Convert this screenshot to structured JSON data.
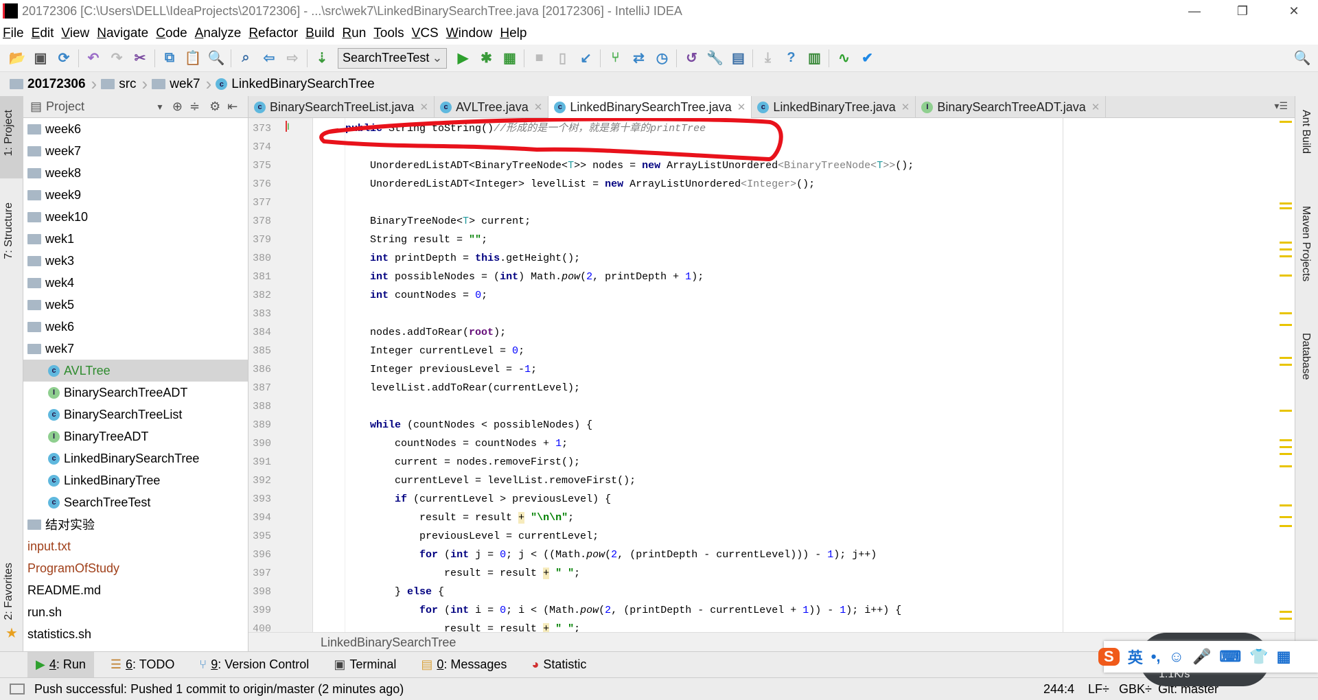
{
  "window": {
    "title": "20172306 [C:\\Users\\DELL\\IdeaProjects\\20172306] - ...\\src\\wek7\\LinkedBinarySearchTree.java [20172306] - IntelliJ IDEA",
    "logo": "IJ",
    "minimize": "—",
    "restore": "❐",
    "close": "✕"
  },
  "menu": [
    "File",
    "Edit",
    "View",
    "Navigate",
    "Code",
    "Analyze",
    "Refactor",
    "Build",
    "Run",
    "Tools",
    "VCS",
    "Window",
    "Help"
  ],
  "toolbar": {
    "run_config": "SearchTreeTest",
    "icons_left": [
      {
        "name": "open-icon",
        "g": "📂",
        "c": "#d9a441"
      },
      {
        "name": "save-icon",
        "g": "▣",
        "c": "#555"
      },
      {
        "name": "sync-icon",
        "g": "⟳",
        "c": "#3a86c8"
      },
      {
        "name": "undo-icon",
        "g": "↶",
        "c": "#9a6cc8"
      },
      {
        "name": "redo-icon",
        "g": "↷",
        "c": "#bbb"
      },
      {
        "name": "cut-icon",
        "g": "✂",
        "c": "#7a4aa0"
      },
      {
        "name": "copy-icon",
        "g": "⧉",
        "c": "#3a86c8"
      },
      {
        "name": "paste-icon",
        "g": "📋",
        "c": "#c08030"
      },
      {
        "name": "find-icon",
        "g": "🔍",
        "c": "#3a6ea5"
      },
      {
        "name": "replace-icon",
        "g": "⌕",
        "c": "#3a6ea5"
      },
      {
        "name": "back-icon",
        "g": "⇦",
        "c": "#3a86c8"
      },
      {
        "name": "forward-icon",
        "g": "⇨",
        "c": "#bbb"
      },
      {
        "name": "build-icon",
        "g": "⇣",
        "c": "#3a9a3a"
      }
    ],
    "icons_right": [
      {
        "name": "run-icon",
        "g": "▶",
        "c": "#2ea02e"
      },
      {
        "name": "debug-icon",
        "g": "✱",
        "c": "#3a9a3a"
      },
      {
        "name": "coverage-icon",
        "g": "▦",
        "c": "#3a9a3a"
      },
      {
        "name": "stop-icon",
        "g": "■",
        "c": "#bbb"
      },
      {
        "name": "attach-icon",
        "g": "▯",
        "c": "#bbb"
      },
      {
        "name": "vcs-update-icon",
        "g": "↙",
        "c": "#3a86c8"
      },
      {
        "name": "vcs-branch-icon",
        "g": "⑂",
        "c": "#4caf50"
      },
      {
        "name": "vcs-merge-icon",
        "g": "⇄",
        "c": "#3a86c8"
      },
      {
        "name": "history-icon",
        "g": "◷",
        "c": "#3a86c8"
      },
      {
        "name": "revert-icon",
        "g": "↺",
        "c": "#7a4aa0"
      },
      {
        "name": "settings-icon",
        "g": "🔧",
        "c": "#c08030"
      },
      {
        "name": "project-structure-icon",
        "g": "▤",
        "c": "#3a6ea5"
      },
      {
        "name": "download-icon",
        "g": "⤓",
        "c": "#bbb"
      },
      {
        "name": "help-icon",
        "g": "?",
        "c": "#3a86c8"
      },
      {
        "name": "sdk-icon",
        "g": "▥",
        "c": "#3a8a3a"
      },
      {
        "name": "statistic-icon",
        "g": "∿",
        "c": "#2ea02e"
      },
      {
        "name": "task-icon",
        "g": "✔",
        "c": "#1e88e5"
      }
    ],
    "search": "🔍"
  },
  "breadcrumb": [
    "20172306",
    "src",
    "wek7",
    "LinkedBinarySearchTree"
  ],
  "left_strip": {
    "project": "1: Project",
    "structure": "7: Structure",
    "favorites": "2: Favorites"
  },
  "project": {
    "title": "Project",
    "items": [
      {
        "label": "week6",
        "type": "folder",
        "level": 0
      },
      {
        "label": "week7",
        "type": "folder",
        "level": 0
      },
      {
        "label": "week8",
        "type": "folder",
        "level": 0
      },
      {
        "label": "week9",
        "type": "folder",
        "level": 0
      },
      {
        "label": "week10",
        "type": "folder",
        "level": 0
      },
      {
        "label": "wek1",
        "type": "folder",
        "level": 0
      },
      {
        "label": "wek3",
        "type": "folder",
        "level": 0
      },
      {
        "label": "wek4",
        "type": "folder",
        "level": 0
      },
      {
        "label": "wek5",
        "type": "folder",
        "level": 0
      },
      {
        "label": "wek6",
        "type": "folder",
        "level": 0
      },
      {
        "label": "wek7",
        "type": "folder",
        "level": 0
      },
      {
        "label": "AVLTree",
        "type": "class",
        "level": 1,
        "selected": true,
        "color": "#2e8b2e"
      },
      {
        "label": "BinarySearchTreeADT",
        "type": "interface",
        "level": 1
      },
      {
        "label": "BinarySearchTreeList",
        "type": "class",
        "level": 1
      },
      {
        "label": "BinaryTreeADT",
        "type": "interface",
        "level": 1
      },
      {
        "label": "LinkedBinarySearchTree",
        "type": "class",
        "level": 1
      },
      {
        "label": "LinkedBinaryTree",
        "type": "class",
        "level": 1
      },
      {
        "label": "SearchTreeTest",
        "type": "class",
        "level": 1
      },
      {
        "label": "结对实验",
        "type": "folder",
        "level": 0
      },
      {
        "label": "input.txt",
        "type": "file",
        "level": 0,
        "color": "#a0401a"
      },
      {
        "label": "ProgramOfStudy",
        "type": "file",
        "level": 0,
        "color": "#a0401a"
      },
      {
        "label": "README.md",
        "type": "file",
        "level": 0
      },
      {
        "label": "run.sh",
        "type": "file",
        "level": 0
      },
      {
        "label": "statistics.sh",
        "type": "file",
        "level": 0
      }
    ]
  },
  "tabs": [
    {
      "label": "BinarySearchTreeList.java",
      "type": "class"
    },
    {
      "label": "AVLTree.java",
      "type": "class"
    },
    {
      "label": "LinkedBinarySearchTree.java",
      "type": "class",
      "active": true
    },
    {
      "label": "LinkedBinaryTree.java",
      "type": "class"
    },
    {
      "label": "BinarySearchTreeADT.java",
      "type": "interface"
    }
  ],
  "editor": {
    "lines": [
      {
        "n": "373",
        "t": [
          [
            "    ",
            "pl"
          ],
          [
            "public",
            "kw"
          ],
          [
            " String toString()",
            "pl"
          ],
          [
            "//形成的是一个树，就是第十章的printTree",
            "cm"
          ]
        ]
      },
      {
        "n": "374",
        "t": []
      },
      {
        "n": "375",
        "t": [
          [
            "        UnorderedListADT<BinaryTreeNode<",
            "pl"
          ],
          [
            "T",
            "tp"
          ],
          [
            ">> nodes = ",
            "pl"
          ],
          [
            "new",
            "kw"
          ],
          [
            " ArrayListUnordered",
            "pl"
          ],
          [
            "<BinaryTreeNode<",
            "gen"
          ],
          [
            "T",
            "tp"
          ],
          [
            ">>",
            "gen"
          ],
          [
            "();",
            "pl"
          ]
        ]
      },
      {
        "n": "376",
        "t": [
          [
            "        UnorderedListADT<Integer> levelList = ",
            "pl"
          ],
          [
            "new",
            "kw"
          ],
          [
            " ArrayListUnordered",
            "pl"
          ],
          [
            "<Integer>",
            "gen"
          ],
          [
            "();",
            "pl"
          ]
        ]
      },
      {
        "n": "377",
        "t": []
      },
      {
        "n": "378",
        "t": [
          [
            "        BinaryTreeNode<",
            "pl"
          ],
          [
            "T",
            "tp"
          ],
          [
            "> current;",
            "pl"
          ]
        ]
      },
      {
        "n": "379",
        "t": [
          [
            "        String result = ",
            "pl"
          ],
          [
            "\"\"",
            "str"
          ],
          [
            ";",
            "pl"
          ]
        ]
      },
      {
        "n": "380",
        "t": [
          [
            "        ",
            "pl"
          ],
          [
            "int",
            "kw"
          ],
          [
            " printDepth = ",
            "pl"
          ],
          [
            "this",
            "kw"
          ],
          [
            ".getHeight();",
            "pl"
          ]
        ]
      },
      {
        "n": "381",
        "t": [
          [
            "        ",
            "pl"
          ],
          [
            "int",
            "kw"
          ],
          [
            " possibleNodes = (",
            "pl"
          ],
          [
            "int",
            "kw"
          ],
          [
            ") Math.",
            "pl"
          ],
          [
            "pow",
            "it"
          ],
          [
            "(",
            "pl"
          ],
          [
            "2",
            "num"
          ],
          [
            ", printDepth + ",
            "pl"
          ],
          [
            "1",
            "num"
          ],
          [
            ");",
            "pl"
          ]
        ]
      },
      {
        "n": "382",
        "t": [
          [
            "        ",
            "pl"
          ],
          [
            "int",
            "kw"
          ],
          [
            " countNodes = ",
            "pl"
          ],
          [
            "0",
            "num"
          ],
          [
            ";",
            "pl"
          ]
        ]
      },
      {
        "n": "383",
        "t": []
      },
      {
        "n": "384",
        "t": [
          [
            "        nodes.addToRear(",
            "pl"
          ],
          [
            "root",
            "fld"
          ],
          [
            ");",
            "pl"
          ]
        ]
      },
      {
        "n": "385",
        "t": [
          [
            "        Integer currentLevel = ",
            "pl"
          ],
          [
            "0",
            "num"
          ],
          [
            ";",
            "pl"
          ]
        ]
      },
      {
        "n": "386",
        "t": [
          [
            "        Integer previousLevel = -",
            "pl"
          ],
          [
            "1",
            "num"
          ],
          [
            ";",
            "pl"
          ]
        ]
      },
      {
        "n": "387",
        "t": [
          [
            "        levelList.addToRear(currentLevel);",
            "pl"
          ]
        ]
      },
      {
        "n": "388",
        "t": []
      },
      {
        "n": "389",
        "t": [
          [
            "        ",
            "pl"
          ],
          [
            "while",
            "kw"
          ],
          [
            " (countNodes < possibleNodes) {",
            "pl"
          ]
        ]
      },
      {
        "n": "390",
        "t": [
          [
            "            countNodes = countNodes + ",
            "pl"
          ],
          [
            "1",
            "num"
          ],
          [
            ";",
            "pl"
          ]
        ]
      },
      {
        "n": "391",
        "t": [
          [
            "            current = nodes.removeFirst();",
            "pl"
          ]
        ]
      },
      {
        "n": "392",
        "t": [
          [
            "            currentLevel = levelList.removeFirst();",
            "pl"
          ]
        ]
      },
      {
        "n": "393",
        "t": [
          [
            "            ",
            "pl"
          ],
          [
            "if",
            "kw"
          ],
          [
            " (currentLevel > previousLevel) {",
            "pl"
          ]
        ]
      },
      {
        "n": "394",
        "t": [
          [
            "                result = result ",
            "pl"
          ],
          [
            "+",
            "hl"
          ],
          [
            " ",
            "pl"
          ],
          [
            "\"\\n\\n\"",
            "str"
          ],
          [
            ";",
            "pl"
          ]
        ]
      },
      {
        "n": "395",
        "t": [
          [
            "                previousLevel = currentLevel;",
            "pl"
          ]
        ]
      },
      {
        "n": "396",
        "t": [
          [
            "                ",
            "pl"
          ],
          [
            "for",
            "kw"
          ],
          [
            " (",
            "pl"
          ],
          [
            "int",
            "kw"
          ],
          [
            " j = ",
            "pl"
          ],
          [
            "0",
            "num"
          ],
          [
            "; j < ((Math.",
            "pl"
          ],
          [
            "pow",
            "it"
          ],
          [
            "(",
            "pl"
          ],
          [
            "2",
            "num"
          ],
          [
            ", (printDepth - currentLevel))) - ",
            "pl"
          ],
          [
            "1",
            "num"
          ],
          [
            "); j++)",
            "pl"
          ]
        ]
      },
      {
        "n": "397",
        "t": [
          [
            "                    result = result ",
            "pl"
          ],
          [
            "+",
            "hl"
          ],
          [
            " ",
            "pl"
          ],
          [
            "\" \"",
            "str"
          ],
          [
            ";",
            "pl"
          ]
        ]
      },
      {
        "n": "398",
        "t": [
          [
            "            } ",
            "pl"
          ],
          [
            "else",
            "kw"
          ],
          [
            " {",
            "pl"
          ]
        ]
      },
      {
        "n": "399",
        "t": [
          [
            "                ",
            "pl"
          ],
          [
            "for",
            "kw"
          ],
          [
            " (",
            "pl"
          ],
          [
            "int",
            "kw"
          ],
          [
            " i = ",
            "pl"
          ],
          [
            "0",
            "num"
          ],
          [
            "; i < (Math.",
            "pl"
          ],
          [
            "pow",
            "it"
          ],
          [
            "(",
            "pl"
          ],
          [
            "2",
            "num"
          ],
          [
            ", (printDepth - currentLevel + ",
            "pl"
          ],
          [
            "1",
            "num"
          ],
          [
            ")) - ",
            "pl"
          ],
          [
            "1",
            "num"
          ],
          [
            "); i++) {",
            "pl"
          ]
        ]
      },
      {
        "n": "400",
        "t": [
          [
            "                    result = result ",
            "pl"
          ],
          [
            "+",
            "hl"
          ],
          [
            " ",
            "pl"
          ],
          [
            "\" \"",
            "str"
          ],
          [
            ";",
            "pl"
          ]
        ]
      }
    ],
    "footer": "LinkedBinarySearchTree",
    "annotation_color": "#e8121b"
  },
  "right_strip": {
    "ant": "Ant Build",
    "maven": "Maven Projects",
    "database": "Database"
  },
  "tool_windows": [
    {
      "key": "4",
      "label": ": Run",
      "icon": "▶",
      "color": "#2ea02e",
      "active": true
    },
    {
      "key": "6",
      "label": ": TODO",
      "icon": "☰",
      "color": "#c08030"
    },
    {
      "key": "9",
      "label": ": Version Control",
      "icon": "⑂",
      "color": "#3a86c8"
    },
    {
      "key": "",
      "label": "Terminal",
      "icon": "▣",
      "color": "#444"
    },
    {
      "key": "0",
      "label": ": Messages",
      "icon": "▤",
      "color": "#d9a441"
    },
    {
      "key": "",
      "label": "Statistic",
      "icon": "◕",
      "color": "#d03030"
    }
  ],
  "status": {
    "message": "Push successful: Pushed 1 commit to origin/master (2 minutes ago)",
    "position": "244:4",
    "line_sep": "LF÷",
    "encoding": "GBK÷",
    "vcs": "Git: master"
  },
  "ime": {
    "logo": "S",
    "lang": "英",
    "items": [
      "•,",
      "☺",
      "🎤",
      "⌨",
      "👕",
      "▦"
    ],
    "net_speed": "1.1K/s"
  }
}
